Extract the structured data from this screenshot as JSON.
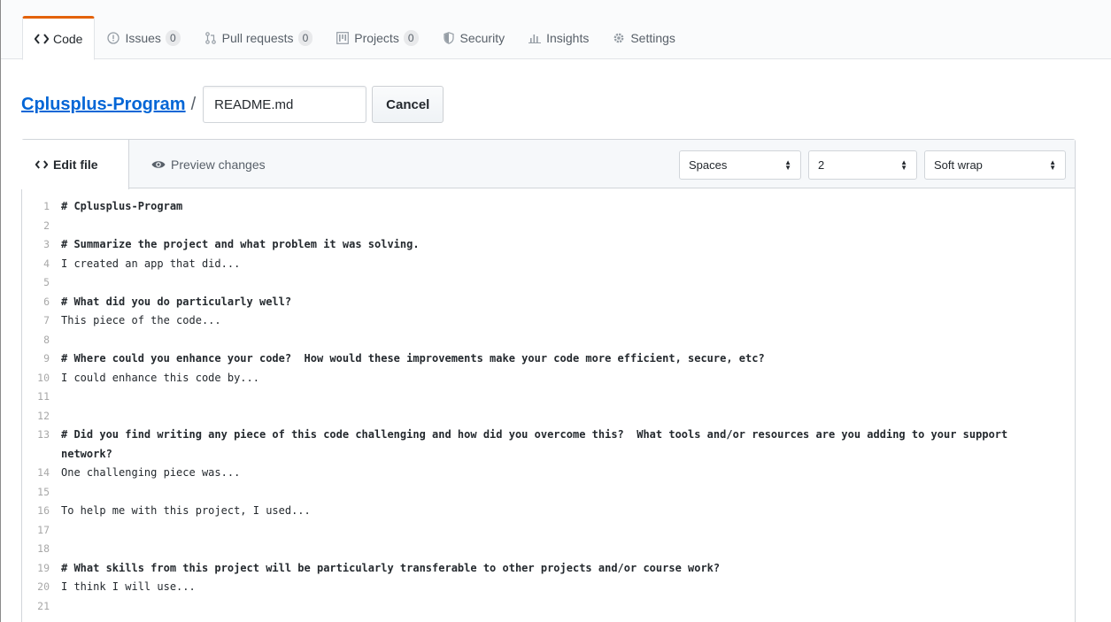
{
  "reponav": {
    "tabs": [
      {
        "label": "Code",
        "icon": "code-icon",
        "counter": null,
        "selected": true
      },
      {
        "label": "Issues",
        "icon": "issue-opened-icon",
        "counter": "0",
        "selected": false
      },
      {
        "label": "Pull requests",
        "icon": "git-pull-request-icon",
        "counter": "0",
        "selected": false
      },
      {
        "label": "Projects",
        "icon": "project-icon",
        "counter": "0",
        "selected": false
      },
      {
        "label": "Security",
        "icon": "shield-icon",
        "counter": null,
        "selected": false
      },
      {
        "label": "Insights",
        "icon": "graph-icon",
        "counter": null,
        "selected": false
      },
      {
        "label": "Settings",
        "icon": "gear-icon",
        "counter": null,
        "selected": false
      }
    ]
  },
  "breadcrumb": {
    "repo": "Cplusplus-Program",
    "separator": "/",
    "filename": "README.md",
    "cancel_label": "Cancel"
  },
  "editor": {
    "edit_tab": "Edit file",
    "preview_tab": "Preview changes",
    "indent_mode": "Spaces",
    "indent_size": "2",
    "wrap_mode": "Soft wrap",
    "lines": [
      {
        "n": "1",
        "text": "# Cplusplus-Program",
        "heading": true
      },
      {
        "n": "2",
        "text": "",
        "heading": false
      },
      {
        "n": "3",
        "text": "# Summarize the project and what problem it was solving.",
        "heading": true
      },
      {
        "n": "4",
        "text": "I created an app that did...",
        "heading": false
      },
      {
        "n": "5",
        "text": "",
        "heading": false
      },
      {
        "n": "6",
        "text": "# What did you do particularly well?",
        "heading": true
      },
      {
        "n": "7",
        "text": "This piece of the code...",
        "heading": false
      },
      {
        "n": "8",
        "text": "",
        "heading": false
      },
      {
        "n": "9",
        "text": "# Where could you enhance your code?  How would these improvements make your code more efficient, secure, etc?",
        "heading": true
      },
      {
        "n": "10",
        "text": "I could enhance this code by...",
        "heading": false
      },
      {
        "n": "11",
        "text": "",
        "heading": false
      },
      {
        "n": "12",
        "text": "",
        "heading": false
      },
      {
        "n": "13",
        "text": "# Did you find writing any piece of this code challenging and how did you overcome this?  What tools and/or resources are you adding to your support network?",
        "heading": true
      },
      {
        "n": "14",
        "text": "One challenging piece was...",
        "heading": false
      },
      {
        "n": "15",
        "text": "",
        "heading": false
      },
      {
        "n": "16",
        "text": "To help me with this project, I used...",
        "heading": false
      },
      {
        "n": "17",
        "text": "",
        "heading": false
      },
      {
        "n": "18",
        "text": "",
        "heading": false
      },
      {
        "n": "19",
        "text": "# What skills from this project will be particularly transferable to other projects and/or course work?",
        "heading": true
      },
      {
        "n": "20",
        "text": "I think I will use...",
        "heading": false
      },
      {
        "n": "21",
        "text": "",
        "heading": false
      }
    ]
  },
  "colors": {
    "link": "#0366d6",
    "selected_tab_accent": "#e36209",
    "border": "#d1d5da"
  }
}
